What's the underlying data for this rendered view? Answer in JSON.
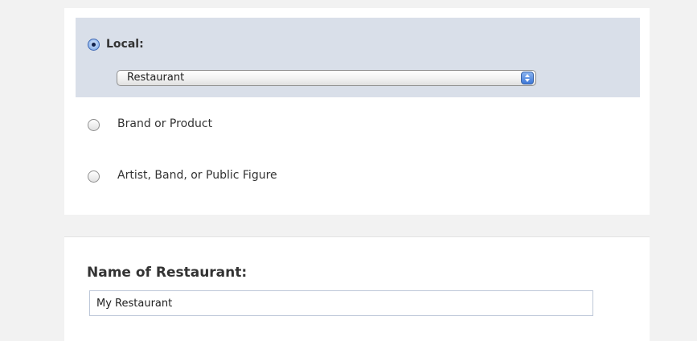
{
  "category_options": [
    {
      "label": "Local:",
      "selected": true
    },
    {
      "label": "Brand or Product",
      "selected": false
    },
    {
      "label": "Artist, Band, or Public Figure",
      "selected": false
    }
  ],
  "local_select": {
    "value": "Restaurant"
  },
  "name_section": {
    "title": "Name of Restaurant:",
    "input_value": "My Restaurant"
  },
  "colors": {
    "page_background": "#f2f2f2",
    "panel_background": "#ffffff",
    "selected_option_background": "#d9dfe9",
    "input_border": "#bdc7d8"
  },
  "icons": {
    "radio_selected": "radio-selected-icon",
    "radio_unselected": "radio-unselected-icon",
    "select_arrows": "select-arrows-icon"
  }
}
